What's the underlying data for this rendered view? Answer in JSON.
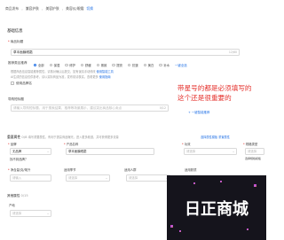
{
  "breadcrumb": {
    "items": [
      "商品发布",
      "兼容护肤",
      "美容护肤",
      "美容仪/眼霜"
    ],
    "link": "切换"
  },
  "basic_info": {
    "section_title": "基础信息",
    "title_label": "商品标题",
    "title_value": "草本面膜眼霜",
    "title_counter": "12/60",
    "reco_label": "推荐类目推荐",
    "radio_options": [
      "全部",
      "保湿",
      "修护",
      "舒缓",
      "紧致",
      "提亮",
      "抗皱",
      "美白",
      "补水"
    ],
    "reco_more": "一键全选",
    "reco_hint": "根据商品信息智能推荐属性，请核对确认后提交，如有误请手动修改",
    "reco_hint_link": "使用智能工具",
    "ai_hint": "AI生成的信息仅供参考，请以实际商品为准，发布前请核实。查看更多",
    "ai_hint_link": "使用指南",
    "checkbox_label": "使用品牌名",
    "guide_label": "导购短标题",
    "guide_placeholder": "请输入导购短标题，用于搜索结果、推荐等场景展示，建议突出商品核心卖点",
    "guide_counter": "0/12",
    "add_guide": "+ 一键智能推荐"
  },
  "notice": {
    "line1": "带星号的都是必须填写的",
    "line2": "这个还是很重要的"
  },
  "attributes": {
    "section_title": "重要属性",
    "section_progress": "0/8",
    "section_hint": "填写重要属性，有利于提高商品曝光，进入更多频道，并可获得更多流量",
    "section_link1": "选择属性模板",
    "section_link2": "重置属性",
    "brand_label": "品牌",
    "brand_value": "无品牌",
    "brand_link": "找不到品牌？",
    "product_name_label": "产品名称",
    "product_name_value": "草本面膜眼霜",
    "effect_label": "功效",
    "effect_placeholder": "请选择",
    "spec_label": "规格类型",
    "spec_placeholder": "请选择",
    "spec_link": "选择规格模板",
    "net_label": "净含量/克/毫升",
    "net_placeholder": "请输入",
    "season_label": "适用季节",
    "season_placeholder": "请选择",
    "people_label": "适用人群",
    "people_placeholder": "请选择",
    "skin_label": "适用肤质",
    "skin_placeholder": "请选择",
    "other_title": "其他属性",
    "other_progress": "0/15",
    "origin_label": "产地",
    "origin_placeholder": "请选择"
  },
  "logo": {
    "text": "日正商城"
  },
  "colors": {
    "accent": "#1f6fe5",
    "required": "#e5322d",
    "logo_bg": "#15141c"
  }
}
